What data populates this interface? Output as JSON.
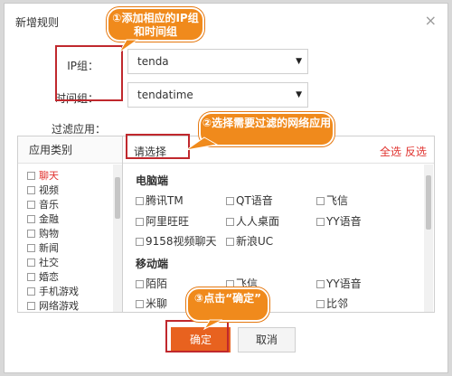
{
  "dialog": {
    "title": "新增规则",
    "close_glyph": "×",
    "ip_group_label": "IP组：",
    "ip_group_value": "tenda",
    "time_group_label": "时间组：",
    "time_group_value": "tendatime",
    "filter_label": "过滤应用：",
    "category_header": "应用类别",
    "categories": [
      "聊天",
      "视频",
      "音乐",
      "金融",
      "购物",
      "新闻",
      "社交",
      "婚恋",
      "手机游戏",
      "网络游戏"
    ],
    "active_category": "聊天",
    "please_select": "请选择",
    "select_all": "全选",
    "select_inverse": "反选",
    "groups": [
      {
        "title": "电脑端",
        "apps": [
          "腾讯TM",
          "QT语音",
          "飞信",
          "阿里旺旺",
          "人人桌面",
          "YY语音",
          "9158视频聊天",
          "新浪UC"
        ]
      },
      {
        "title": "移动端",
        "apps": [
          "陌陌",
          "飞信",
          "YY语音",
          "米聊",
          "",
          "比邻"
        ]
      }
    ],
    "ok_label": "确定",
    "cancel_label": "取消"
  },
  "callouts": {
    "c1": "①添加相应的IP组和时间组",
    "c2": "②选择需要过滤的网络应用",
    "c3": "③点击“确定”"
  },
  "watermark": {
    "main": "路由器",
    "sub": "luyouqi.com"
  },
  "colors": {
    "accent": "#e8621f",
    "annotation": "#f08a1c",
    "box": "#c0282d",
    "link": "#e0322e"
  }
}
